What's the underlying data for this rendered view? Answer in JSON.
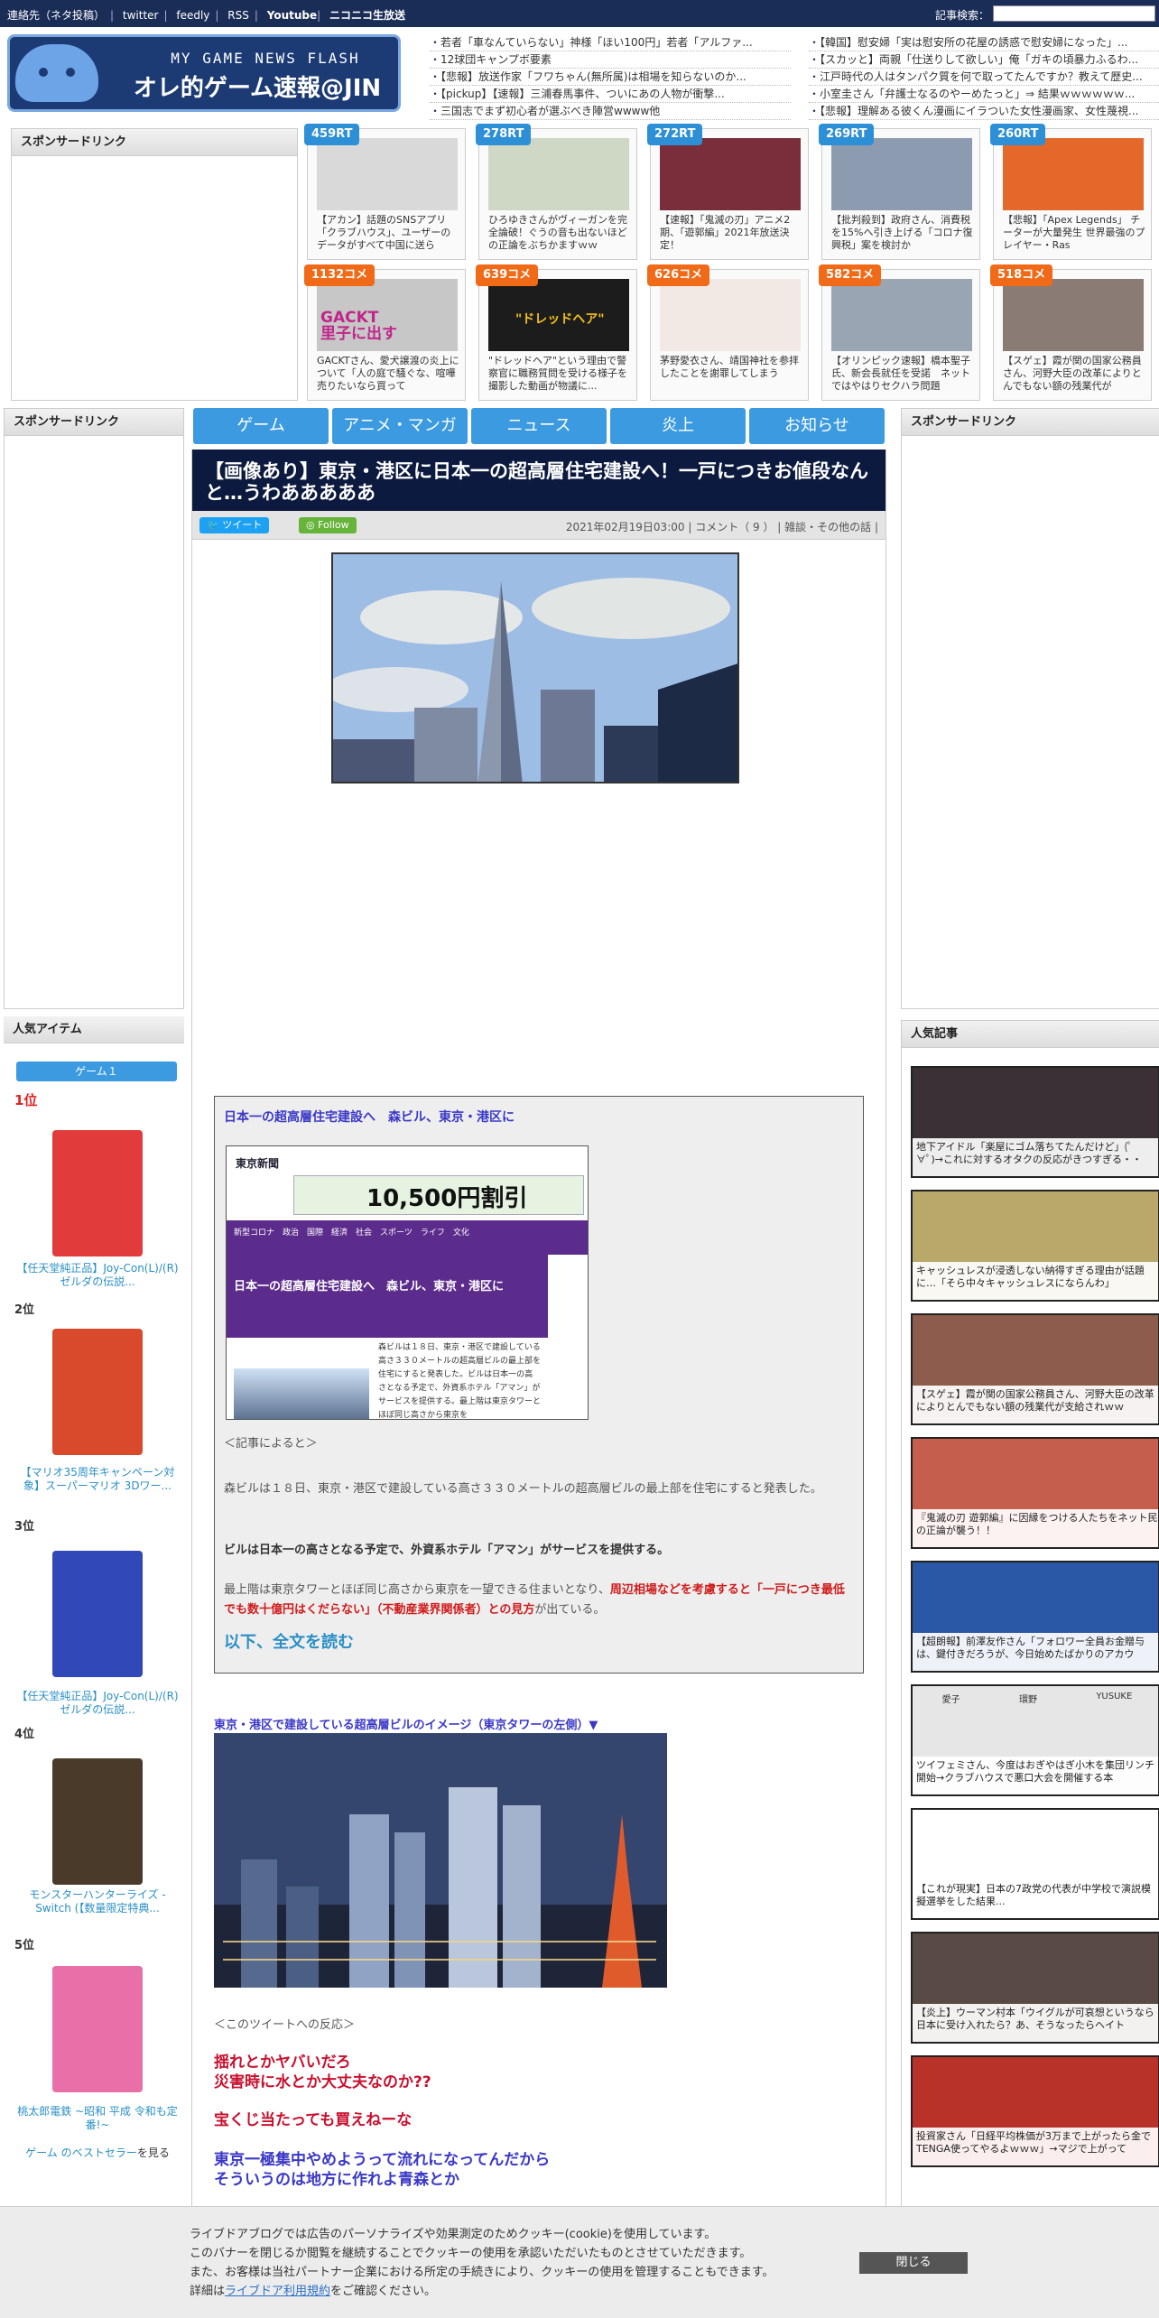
{
  "topbar": {
    "links": [
      "連絡先（ネタ投稿）",
      "twitter",
      "feedly",
      "RSS",
      "Youtube",
      "ニコニコ生放送"
    ],
    "search_label": "記事検索："
  },
  "logo": {
    "small": "MY GAME NEWS FLASH",
    "big": "オレ的ゲーム速報@JIN"
  },
  "headlines": {
    "left": [
      "若者「車なんていらない」神様「ほい100円」若者「アルファ...",
      "12球団キャンプボ要素",
      "【悲報】放送作家「フワちゃん(無所属)は相場を知らないのか...",
      "【pickup】【速報】三浦春馬事件、ついにあの人物が衝撃...",
      "三国志でまず初心者が選ぶべき陣営wwww他"
    ],
    "right": [
      "【韓国】慰安婦「実は慰安所の花屋の誘惑で慰安婦になった」...",
      "【スカッと】両親「仕送りして欲しい」俺「ガキの頃暴力ふるわ...",
      "江戸時代の人はタンパク質を何で取ってたんですか？教えて歴史...",
      "小室圭さん「弁護士なるのやーめたっと」⇒ 結果ｗｗｗｗｗｗ...",
      "【悲報】理解ある彼くん漫画にイラついた女性漫画家、女性蔑視..."
    ]
  },
  "sponsor": {
    "label": "スポンサードリンク"
  },
  "thumbs": [
    {
      "badge": "459RT",
      "kind": "rt",
      "text": "【アカン】話題のSNSアプリ「クラブハウス」、ユーザーのデータがすべて中国に送ら",
      "color": "#d9d9d9"
    },
    {
      "badge": "278RT",
      "kind": "rt",
      "text": "ひろゆきさんがヴィーガンを完全論破！ぐうの音も出ないほどの正論をぶちかますｗｗ",
      "color": "#cfd8c4"
    },
    {
      "badge": "272RT",
      "kind": "rt",
      "text": "【速報】「鬼滅の刃」アニメ2期、「遊郭編」2021年放送決定！",
      "color": "#7a2d3a"
    },
    {
      "badge": "269RT",
      "kind": "rt",
      "text": "【批判殺到】政府さん、消費税を15%へ引き上げる「コロナ復興税」案を検討か",
      "color": "#8c9bb0"
    },
    {
      "badge": "260RT",
      "kind": "rt",
      "text": "【悲報】「Apex Legends」 チーターが大量発生 世界最強のプレイヤー・Ras",
      "color": "#e5682b"
    },
    {
      "badge": "1132コメ",
      "kind": "cm",
      "text": "GACKTさん、愛犬譲渡の炎上について「人の庭で騒ぐな、喧嘩売りたいなら買って",
      "color": "#c7c7c7"
    },
    {
      "badge": "639コメ",
      "kind": "cm",
      "text": "\"ドレッドヘア\"という理由で警察官に職務質問を受ける様子を撮影した動画が物議に...",
      "color": "#1c1c1c"
    },
    {
      "badge": "626コメ",
      "kind": "cm",
      "text": "茅野愛衣さん、靖国神社を参拝したことを謝罪してしまう",
      "color": "#f2e9e4"
    },
    {
      "badge": "582コメ",
      "kind": "cm",
      "text": "【オリンピック速報】橋本聖子氏、新会長就任を受諾　ネットではやはりセクハラ問題",
      "color": "#9aa5b4"
    },
    {
      "badge": "518コメ",
      "kind": "cm",
      "text": "【スゲェ】霞が関の国家公務員さん、河野大臣の改革によりとんでもない額の残業代が",
      "color": "#8a7c74"
    }
  ],
  "thumb_overlay": {
    "gackt": "GACKT\n里子に出す",
    "dread": "\"ドレッドヘア\""
  },
  "nav": [
    "ゲーム",
    "アニメ・マンガ",
    "ニュース",
    "炎上",
    "お知らせ"
  ],
  "article": {
    "title": "【画像あり】東京・港区に日本一の超高層住宅建設へ！一戸につきお値段なんと…うわあああああ",
    "tweet": "ツイート",
    "follow": "Follow",
    "date": "2021年02月19日03:00",
    "comment": "コメント（ 9 ）",
    "category": "雑談・その他の話",
    "quote_head": "日本一の超高層住宅建設へ　森ビル、東京・港区に",
    "news": {
      "np": "東京新聞",
      "ad": "10,500円割引",
      "menu": "新型コロナ　政治　国際　経済　社会　スポーツ　ライフ　文化",
      "headline": "日本一の超高層住宅建設へ　森ビル、東京・港区に",
      "body": "森ビルは１８日、東京・港区で建設している高さ３３０メートルの超高層ビルの最上部を住宅にすると発表した。ビルは日本一の高さとなる予定で、外資系ホテル「アマン」がサービスを提供する。最上階は東京タワーとほぼ同じ高さから東京を"
    },
    "according": "＜記事によると＞",
    "p1": "森ビルは１８日、東京・港区で建設している高さ３３０メートルの超高層ビルの最上部を住宅にすると発表した。",
    "p2": "ビルは日本一の高さとなる予定で、外資系ホテル「アマン」がサービスを提供する。",
    "p3a": "最上階は東京タワーとほぼ同じ高さから東京を一望できる住まいとなり、",
    "p3b": "周辺相場などを考慮すると「一戸につき最低でも数十億円はくだらない」（不動産業界関係者）との見方",
    "p3c": "が出ている。",
    "more": "以下、全文を読む",
    "caption2": "東京・港区で建設している超高層ビルのイメージ（東京タワーの左側）▼",
    "reaction": "＜このツイートへの反応＞",
    "r1": "揺れとかヤバいだろ\n災害時に水とか大丈夫なのか??",
    "r2": "宝くじ当たっても買えねーな",
    "r3": "東京一極集中やめようって流れになってんだから\nそういうのは地方に作れよ青森とか"
  },
  "items": {
    "header": "人気アイテム",
    "button": "ゲーム１",
    "list": [
      {
        "rank": "1位",
        "title": "【任天堂純正品】Joy-Con(L)/(R) ゼルダの伝説...",
        "color": "#e23b3b"
      },
      {
        "rank": "2位",
        "title": "【マリオ35周年キャンペーン対象】スーパーマリオ 3Dワー...",
        "color": "#d94a2c"
      },
      {
        "rank": "3位",
        "title": "【任天堂純正品】Joy-Con(L)/(R) ゼルダの伝説...",
        "color": "#3048b8"
      },
      {
        "rank": "4位",
        "title": "モンスターハンターライズ -Switch (【数量限定特典...",
        "color": "#4a3a2a"
      },
      {
        "rank": "5位",
        "title": "桃太郎電鉄 ~昭和 平成 令和も定番!~",
        "color": "#e86fa8"
      }
    ],
    "bestseller_link": "ゲーム のベストセラー",
    "bestseller_suffix": "を見る"
  },
  "popular": {
    "header": "人気記事",
    "list": [
      {
        "cap": "地下アイドル「楽屋にゴム落ちてたんだけど」(ﾟ∀ﾟ)→これに対するオタクの反応がきつすぎる・・",
        "color": "#3a3035"
      },
      {
        "cap": "キャッシュレスが浸透しない納得すぎる理由が話題に…「そら中々キャッシュレスにならんわ」",
        "color": "#b8a86a"
      },
      {
        "cap": "【スゲェ】霞が関の国家公務員さん、河野大臣の改革によりとんでもない額の残業代が支給されｗｗ",
        "color": "#8e5c4c"
      },
      {
        "cap": "『鬼滅の刃 遊郭編』に因縁をつける人たちをネット民の正論が襲う！！",
        "color": "#c65e4e"
      },
      {
        "cap": "【超朗報】前澤友作さん「フォロワー全員お金贈与は、鍵付きだろうが、今日始めたばかりのアカウ",
        "color": "#2a58a6"
      },
      {
        "cap": "ツイフェミさん、今度はおぎやはぎ小木を集団リンチ開始→クラブハウスで悪口大会を開催する本",
        "color": "#e6e6e6"
      },
      {
        "cap": "【これが現実】日本の7政党の代表が中学校で演説模擬選挙をした結果...",
        "color": "#ffffff"
      },
      {
        "cap": "【炎上】ウーマン村本「ウイグルが可哀想というなら日本に受け入れたら？あ、そうなったらヘイト",
        "color": "#5a4a46"
      },
      {
        "cap": "投資家さん「日経平均株価が3万まで上がったら金でTENGA使ってやるよｗｗｗ」→マジで上がって",
        "color": "#b8322a"
      }
    ],
    "card_names": [
      "愛子",
      "環野",
      "YUSUKE"
    ]
  },
  "cookie": {
    "l1": "ライブドアブログでは広告のパーソナライズや効果測定のためクッキー(cookie)を使用しています。",
    "l2": "このバナーを閉じるか閲覧を継続することでクッキーの使用を承認いただいたものとさせていただきます。",
    "l3": "また、お客様は当社パートナー企業における所定の手続きにより、クッキーの使用を管理することもできます。",
    "l4_pre": "詳細は",
    "l4_link": "ライブドア利用規約",
    "l4_post": "をご確認ください。",
    "close": "閉じる"
  }
}
